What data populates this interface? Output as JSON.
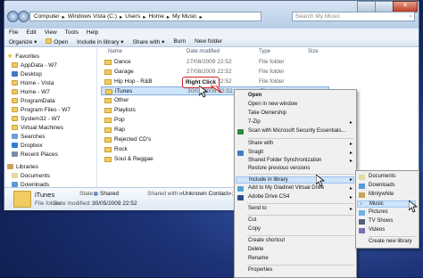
{
  "breadcrumb": [
    "Computer",
    "Windows Vista (C:)",
    "Users",
    "Home",
    "My Music"
  ],
  "search_placeholder": "Search My Music",
  "menubar": [
    "File",
    "Edit",
    "View",
    "Tools",
    "Help"
  ],
  "toolbar": {
    "organize": "Organize",
    "open": "Open",
    "include": "Include in library",
    "share": "Share with",
    "burn": "Burn",
    "new_folder": "New folder"
  },
  "columns": {
    "name": "Name",
    "date": "Date modified",
    "type": "Type",
    "size": "Size"
  },
  "nav": {
    "favorites": "Favorites",
    "favorites_items": [
      "AppData - W7",
      "Desktop",
      "Home - Vista",
      "Home - W7",
      "ProgramData",
      "Program Files - W7",
      "System32 - W7",
      "Virtual Machines",
      "Searches",
      "Dropbox",
      "Recent Places"
    ],
    "libraries": "Libraries",
    "libraries_items": [
      "Documents",
      "Downloads"
    ]
  },
  "files": [
    {
      "name": "Dance",
      "date": "27/08/2009 22:52",
      "type": "File folder"
    },
    {
      "name": "Garage",
      "date": "27/08/2009 22:52",
      "type": "File folder"
    },
    {
      "name": "Hip Hop - R&B",
      "date": "27/08/2009 22:52",
      "type": "File folder"
    },
    {
      "name": "iTunes",
      "date": "30/05/2009 22:52",
      "type": "File folder"
    },
    {
      "name": "Other",
      "date": "",
      "type": ""
    },
    {
      "name": "Playlists",
      "date": "",
      "type": ""
    },
    {
      "name": "Pop",
      "date": "",
      "type": ""
    },
    {
      "name": "Rap",
      "date": "",
      "type": ""
    },
    {
      "name": "Rejected CD's",
      "date": "",
      "type": ""
    },
    {
      "name": "Rock",
      "date": "",
      "type": ""
    },
    {
      "name": "Soul & Reggae",
      "date": "",
      "type": ""
    }
  ],
  "details": {
    "name": "iTunes",
    "state_label": "State:",
    "state": "Shared",
    "shared_label": "Shared with:",
    "shared": "«Unknown Contact»; Everyone",
    "kind": "File folder",
    "modified_label": "Date modified:",
    "modified": "30/05/2009 22:52"
  },
  "callout": "Right Click",
  "context_menu": [
    "Open",
    "Open in new window",
    "Take Ownership",
    "7-Zip",
    "Scan with Microsoft Security Essentials...",
    "Share with",
    "Snagit",
    "Shared Folder Synchronization",
    "Restore previous versions",
    "Include in library",
    "Add to My Gladinet Virtual Drive",
    "Adobe Drive CS4",
    "Send to",
    "Cut",
    "Copy",
    "Create shortcut",
    "Delete",
    "Rename",
    "Properties"
  ],
  "submenu": [
    "Documents",
    "Downloads",
    "Mintywhite",
    "Music",
    "Pictures",
    "TV Shows",
    "Videos",
    "Create new library"
  ],
  "colors": {
    "highlight": "#cde4fa",
    "callout_border": "#d42020"
  }
}
